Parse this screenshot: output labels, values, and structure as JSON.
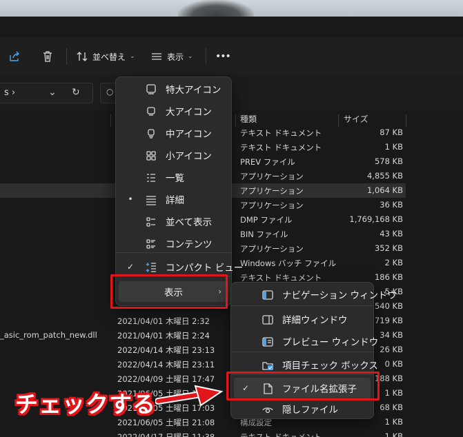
{
  "toolbar": {
    "sort_label": "並べ替え",
    "view_label": "表示",
    "more_label": "•••"
  },
  "address": {
    "crumb_label": "s ›"
  },
  "columns": {
    "type": "種類",
    "size": "サイズ"
  },
  "rows": [
    {
      "type": "テキスト ドキュメント",
      "size": "87 KB"
    },
    {
      "type": "テキスト ドキュメント",
      "size": "1 KB"
    },
    {
      "type": "PREV ファイル",
      "size": "578 KB"
    },
    {
      "type": "アプリケーション",
      "size": "4,855 KB"
    },
    {
      "type": "アプリケーション",
      "size": "1,064 KB"
    },
    {
      "type": "アプリケーション",
      "size": "36 KB"
    },
    {
      "type": "DMP ファイル",
      "size": "1,769,168 KB"
    },
    {
      "type": "BIN ファイル",
      "size": "43 KB"
    },
    {
      "type": "アプリケーション",
      "size": "352 KB"
    },
    {
      "type": "Windows バッチ ファイル",
      "size": "2 KB"
    },
    {
      "type": "テキスト ドキュメント",
      "size": "186 KB"
    },
    {
      "type": "",
      "size": "5 KB"
    },
    {
      "type": "",
      "size": "540 KB"
    },
    {
      "type": "",
      "size": "719 KB"
    },
    {
      "type": "",
      "size": "34 KB"
    },
    {
      "type": "",
      "size": "26 KB"
    },
    {
      "type": "",
      "size": "0 KB"
    },
    {
      "type": "",
      "size": "188 KB"
    },
    {
      "type": "",
      "size": "1 KB"
    },
    {
      "type": "",
      "size": "68 KB"
    },
    {
      "type": "構成設定",
      "size": "1 KB"
    },
    {
      "type": "テキスト ドキュメント",
      "size": "1 KB"
    }
  ],
  "dates": [
    "2021/04/01 木曜日 2:32",
    "2021/04/01 木曜日 2:24",
    "2022/04/14 木曜日 23:13",
    "2022/04/14 木曜日 23:11",
    "2022/04/09 土曜日 17:47",
    "2021/06/05 土曜日 13:15",
    "2021/06/05 土曜日 17:03",
    "2021/06/05 土曜日 21:08",
    "2022/04/17 日曜日 11:38"
  ],
  "side_filename": "_asic_rom_patch_new.dll",
  "view_menu": {
    "items": [
      {
        "label": "特大アイコン",
        "mark": "",
        "icon": "monitor-large-icon"
      },
      {
        "label": "大アイコン",
        "mark": "",
        "icon": "monitor-icon"
      },
      {
        "label": "中アイコン",
        "mark": "",
        "icon": "monitor-medium-icon"
      },
      {
        "label": "小アイコン",
        "mark": "",
        "icon": "grid-small-icon"
      },
      {
        "label": "一覧",
        "mark": "",
        "icon": "list-icon"
      },
      {
        "label": "詳細",
        "mark": "•",
        "icon": "details-icon"
      },
      {
        "label": "並べて表示",
        "mark": "",
        "icon": "tiles-icon"
      },
      {
        "label": "コンテンツ",
        "mark": "",
        "icon": "content-icon"
      },
      {
        "label": "コンパクト ビュー",
        "mark": "✓",
        "icon": "compact-view-icon"
      }
    ],
    "show_label": "表示"
  },
  "show_menu": {
    "items": [
      {
        "label": "ナビゲーション ウィンドウ",
        "mark": "",
        "icon": "nav-pane-icon"
      },
      {
        "label": "詳細ウィンドウ",
        "mark": "",
        "icon": "details-pane-icon"
      },
      {
        "label": "プレビュー ウィンドウ",
        "mark": "",
        "icon": "preview-pane-icon"
      },
      {
        "label": "項目チェック ボックス",
        "mark": "",
        "icon": "item-checkbox-icon"
      },
      {
        "label": "ファイル名拡張子",
        "mark": "✓",
        "icon": "file-extension-icon"
      },
      {
        "label": "隠しファイル",
        "mark": "",
        "icon": "hidden-files-icon"
      }
    ]
  },
  "annotation": {
    "text": "チェックする"
  },
  "colors": {
    "highlight": "#e0161b",
    "menu_bg": "#2b2b2b",
    "window_bg": "#191919"
  }
}
